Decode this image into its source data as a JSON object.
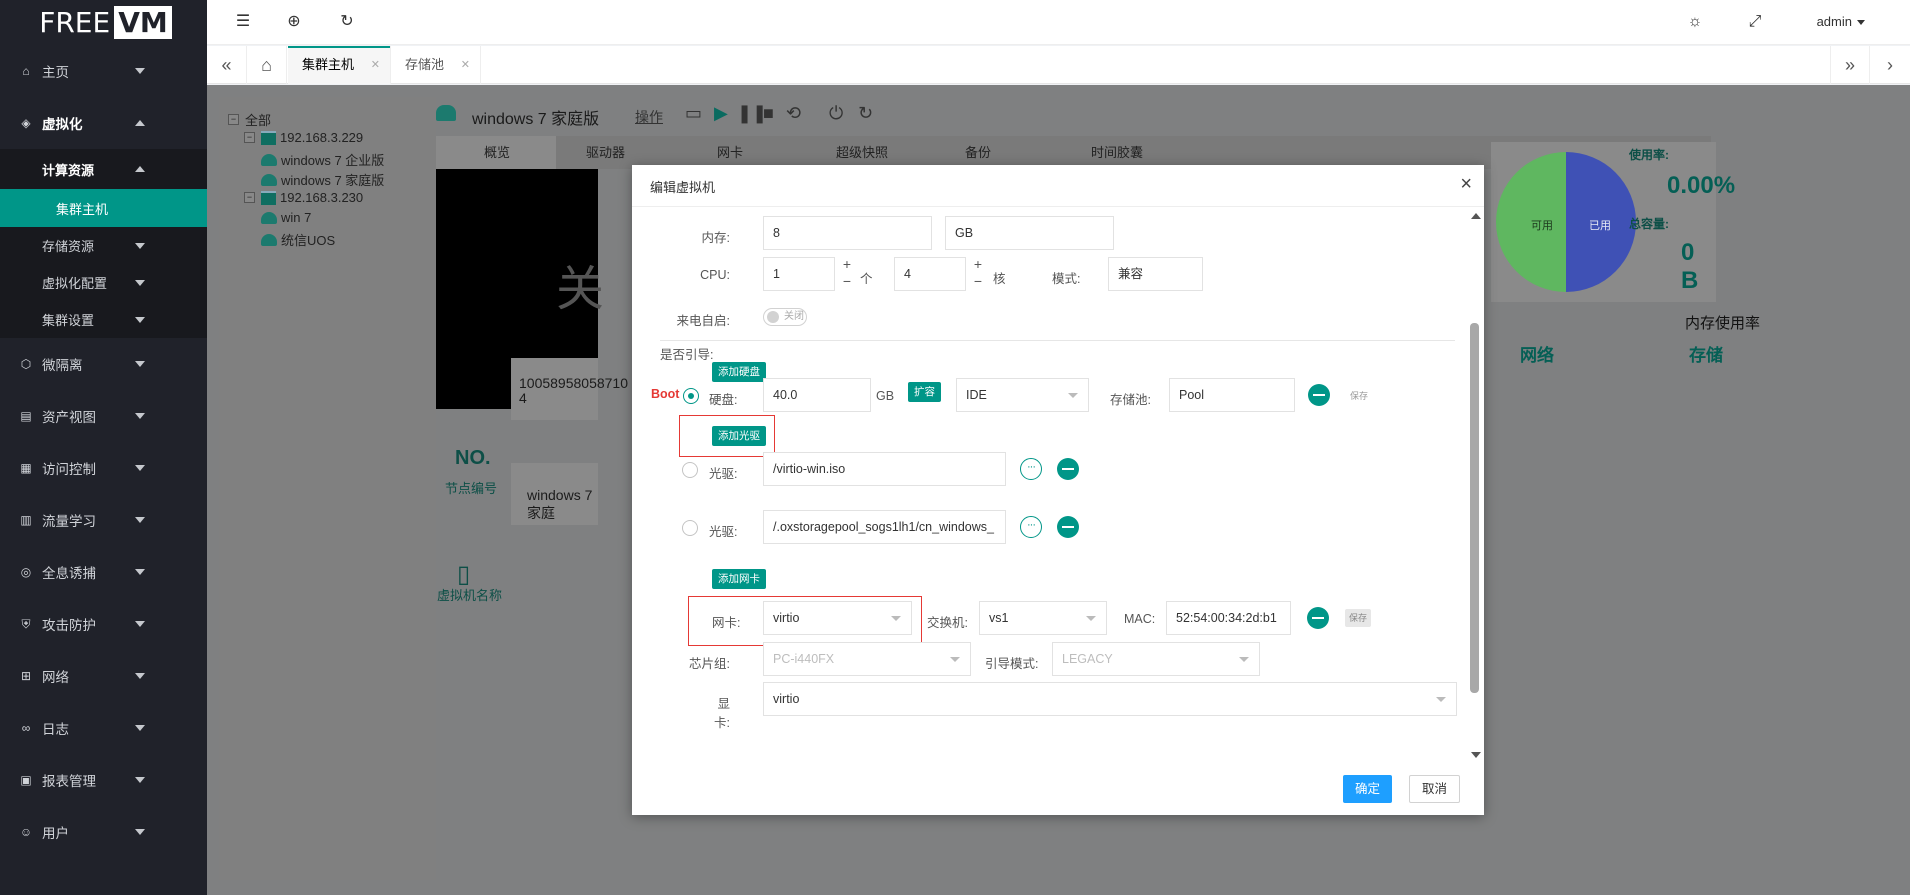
{
  "brand": {
    "logo_left": "FREE",
    "logo_right": "VM"
  },
  "sidebar": {
    "items": [
      {
        "label": "主页"
      },
      {
        "label": "虚拟化"
      },
      {
        "label": "微隔离"
      },
      {
        "label": "资产视图"
      },
      {
        "label": "访问控制"
      },
      {
        "label": "流量学习"
      },
      {
        "label": "全息诱捕"
      },
      {
        "label": "攻击防护"
      },
      {
        "label": "网络"
      },
      {
        "label": "日志"
      },
      {
        "label": "报表管理"
      },
      {
        "label": "用户"
      }
    ],
    "virtualization_sub": [
      {
        "label": "计算资源"
      },
      {
        "label": "存储资源"
      },
      {
        "label": "虚拟化配置"
      },
      {
        "label": "集群设置"
      }
    ],
    "compute_sub": [
      {
        "label": "集群主机"
      }
    ]
  },
  "header": {
    "user": "admin"
  },
  "tabs": [
    {
      "label": "集群主机"
    },
    {
      "label": "存储池"
    }
  ],
  "tree": {
    "root": "全部",
    "hosts": [
      {
        "name": "192.168.3.229",
        "vms": [
          "windows 7 企业版",
          "windows 7 家庭版"
        ]
      },
      {
        "name": "192.168.3.230",
        "vms": [
          "win 7",
          "统信UOS"
        ]
      }
    ]
  },
  "vm": {
    "title": "windows 7 家庭版",
    "op_label": "操作",
    "tabs": [
      "概览",
      "驱动器",
      "网卡",
      "超级快照",
      "备份",
      "时间胶囊"
    ],
    "console_text": "关",
    "node_no_label": "节点编号",
    "node_no_value": "10058958058710",
    "node_no_value2": "4",
    "vm_name_label": "虚拟机名称",
    "vm_name_value": "windows 7 家庭",
    "usage_label": "使用率:",
    "usage_value": "0.00%",
    "total_label": "总容量:",
    "total_value": "0 B",
    "pie_available": "可用",
    "pie_used": "已用",
    "mem_usage_title": "内存使用率",
    "net_label": "网络",
    "storage_label": "存储"
  },
  "modal": {
    "title": "编辑虚拟机",
    "memory_label": "内存:",
    "memory_value": "8",
    "memory_unit": "GB",
    "cpu_label": "CPU:",
    "cpu_value": "1",
    "cpu_unit": "个",
    "cores_value": "4",
    "cores_unit": "核",
    "mode_label": "模式:",
    "mode_value": "兼容",
    "autostart_label": "来电自启:",
    "autostart_value": "关闭",
    "boot_section_label": "是否引导:",
    "add_disk": "添加硬盘",
    "boot_tag": "Boot",
    "disk_label": "硬盘:",
    "disk_value": "40.0",
    "disk_unit": "GB",
    "expand_btn": "扩容",
    "disk_bus": "IDE",
    "pool_label": "存储池:",
    "pool_value": "Pool",
    "save_small": "保存",
    "add_cdrom": "添加光驱",
    "cdrom_label": "光驱:",
    "cdrom1_value": "/virtio-win.iso",
    "cdrom2_value": "/.oxstoragepool_sogs1lh1/cn_windows_",
    "dots": "···",
    "add_nic": "添加网卡",
    "nic_label": "网卡:",
    "nic_value": "virtio",
    "switch_label": "交换机:",
    "switch_value": "vs1",
    "mac_label": "MAC:",
    "mac_value": "52:54:00:34:2d:b1",
    "chipset_label": "芯片组:",
    "chipset_value": "PC-i440FX",
    "boot_mode_label": "引导模式:",
    "boot_mode_value": "LEGACY",
    "display_label": "显卡:",
    "display_value": "virtio",
    "ok": "确定",
    "cancel": "取消"
  },
  "colors": {
    "accent": "#009688",
    "primary": "#1e9fff",
    "sidebar_bg": "#20222a",
    "highlight_red": "#e53935",
    "pie_used": "#3f51b5",
    "pie_available": "#5fb760"
  }
}
